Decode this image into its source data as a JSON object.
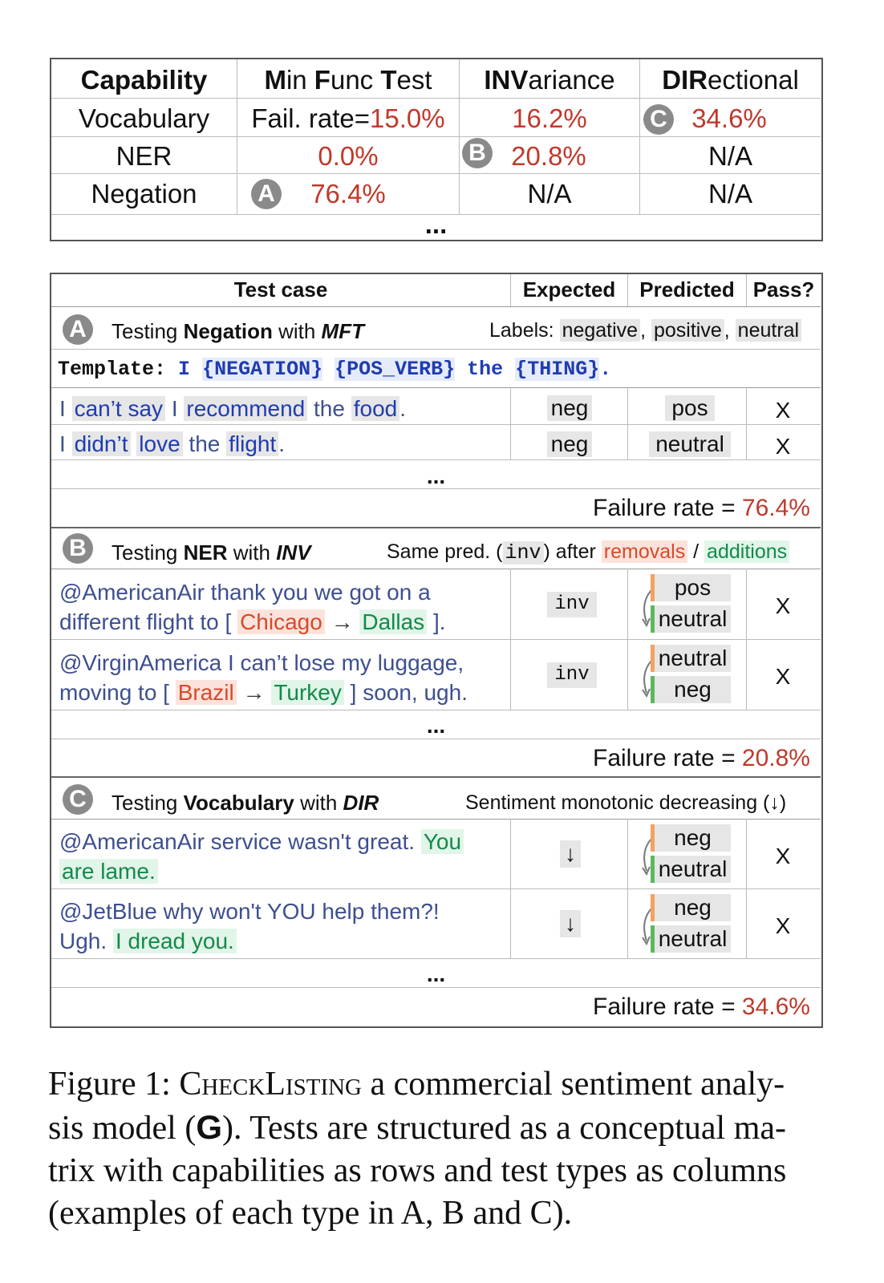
{
  "matrix": {
    "headers": [
      "Capability",
      "Min Func Test",
      "INVariance",
      "DIRectional"
    ],
    "header_parts": {
      "mft": [
        "M",
        "in ",
        "F",
        "unc ",
        "T",
        "est"
      ],
      "inv": [
        "INV",
        "ariance"
      ],
      "dir": [
        "DIR",
        "ectional"
      ]
    },
    "rows": [
      {
        "capability": "Vocabulary",
        "mft_prefix": "Fail. rate=",
        "mft": "15.0%",
        "inv": "16.2%",
        "dir": "34.6%"
      },
      {
        "capability": "NER",
        "mft": "0.0%",
        "inv": "20.8%",
        "dir": "N/A"
      },
      {
        "capability": "Negation",
        "mft": "76.4%",
        "inv": "N/A",
        "dir": "N/A"
      }
    ],
    "ellipsis": "...",
    "badges": {
      "a": "A",
      "b": "B",
      "c": "C"
    }
  },
  "tests": {
    "headers": {
      "case": "Test case",
      "expected": "Expected",
      "predicted": "Predicted",
      "pass": "Pass?"
    },
    "ellipsis": "...",
    "failure_label": "Failure rate = ",
    "sections": {
      "a": {
        "badge": "A",
        "title_pre": "Testing ",
        "capability": "Negation",
        "title_mid": " with ",
        "type": "MFT",
        "labels_prefix": "Labels: ",
        "labels": [
          "negative",
          "positive",
          "neutral"
        ],
        "template_label": "Template:",
        "template_i": "I",
        "template_neg": "{NEGATION}",
        "template_verb": "{POS_VERB}",
        "template_the": "the",
        "template_thing": "{THING}",
        "template_end": ".",
        "rows": [
          {
            "t1": "I ",
            "neg": "can’t say",
            "t2": " I ",
            "verb": "recommend",
            "t3": " the ",
            "thing": "food",
            "t4": ".",
            "expected": "neg",
            "predicted": "pos",
            "pass": "X"
          },
          {
            "t1": "I ",
            "neg": "didn’t",
            "t2": " ",
            "verb": "love",
            "t3": " the ",
            "thing": "flight",
            "t4": ".",
            "expected": "neg",
            "predicted": "neutral",
            "pass": "X"
          }
        ],
        "failure": "76.4%"
      },
      "b": {
        "badge": "B",
        "title_pre": "Testing ",
        "capability": "NER",
        "title_mid": " with ",
        "type": "INV",
        "desc_pre": "Same pred. (",
        "desc_code": "inv",
        "desc_mid": ") after ",
        "desc_rem": "removals",
        "desc_sep": " / ",
        "desc_add": "additions",
        "rows": [
          {
            "line1": "@AmericanAir thank you we got on a",
            "line2_pre": "different flight to [ ",
            "removed": "Chicago",
            "arrow": " → ",
            "added": "Dallas",
            "line2_post": " ].",
            "expected": "inv",
            "pred_before": "pos",
            "pred_after": "neutral",
            "pass": "X"
          },
          {
            "line1": "@VirginAmerica I can’t lose my luggage,",
            "line2_pre": "moving to [ ",
            "removed": "Brazil",
            "arrow": " → ",
            "added": "Turkey",
            "line2_post": " ] soon, ugh.",
            "expected": "inv",
            "pred_before": "neutral",
            "pred_after": "neg",
            "pass": "X"
          }
        ],
        "failure": "20.8%"
      },
      "c": {
        "badge": "C",
        "title_pre": "Testing ",
        "capability": "Vocabulary",
        "title_mid": " with ",
        "type": "DIR",
        "desc": "Sentiment monotonic decreasing (↓)",
        "rows": [
          {
            "text": "@AmericanAir service wasn't great. ",
            "added1": "You",
            "added2": "are lame.",
            "expected": "↓",
            "pred_before": "neg",
            "pred_after": "neutral",
            "pass": "X"
          },
          {
            "text": "@JetBlue why won't YOU help them?!",
            "text2": "Ugh. ",
            "added2": "I dread you.",
            "expected": "↓",
            "pred_before": "neg",
            "pred_after": "neutral",
            "pass": "X"
          }
        ],
        "failure": "34.6%"
      }
    }
  },
  "caption": {
    "prefix": "Figure 1: ",
    "name": "CheckListing",
    "line1_rest": " a commercial sentiment analy-",
    "line2_pre": "sis model (",
    "logo": "G",
    "line2_post": "). Tests are structured as a conceptual ma-",
    "line3": "trix with capabilities as rows and test types as columns",
    "line4": "(examples of each type in A, B and C)."
  },
  "colors": {
    "failure": "#c0392b",
    "removal": "#d84a2b",
    "addition": "#138a4a",
    "template": "#1f3cb0",
    "badge": "#8a8a8a"
  }
}
